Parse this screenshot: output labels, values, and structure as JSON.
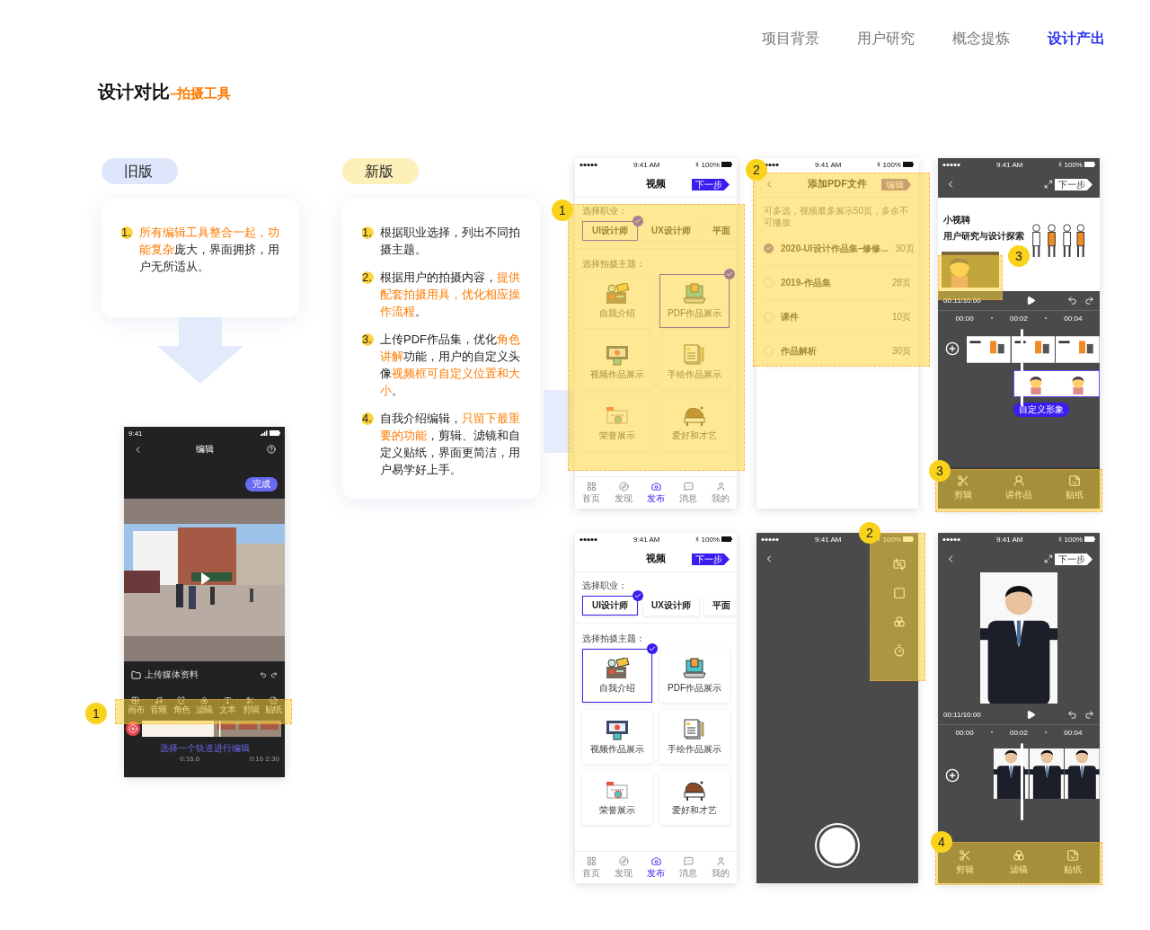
{
  "nav": [
    {
      "label": "项目背景",
      "selected": false
    },
    {
      "label": "用户研究",
      "selected": false
    },
    {
      "label": "概念提炼",
      "selected": false
    },
    {
      "label": "设计产出",
      "selected": true
    }
  ],
  "heading": {
    "title": "设计对比",
    "subtitle": "–拍摄工具"
  },
  "old_version": {
    "badge": "旧版",
    "points": [
      {
        "number": "1.",
        "segments": [
          {
            "text": "所有编辑工具整合一起，功能复杂",
            "highlight": true
          },
          {
            "text": "庞大，界面拥挤，用户无所适从。",
            "highlight": false
          }
        ]
      }
    ],
    "phone": {
      "callout": "1",
      "time": "9:41",
      "title": "编辑",
      "done": "完成",
      "upload": "上传媒体资料",
      "tools": [
        {
          "kind": "canvas",
          "label": "画布"
        },
        {
          "kind": "audio",
          "label": "音频"
        },
        {
          "kind": "role",
          "label": "角色"
        },
        {
          "kind": "filter",
          "label": "滤镜"
        },
        {
          "kind": "text",
          "label": "文本"
        },
        {
          "kind": "cut",
          "label": "剪辑"
        },
        {
          "kind": "sticker",
          "label": "贴纸"
        }
      ],
      "hint": "选择一个轨道进行编辑",
      "times": [
        "0:16.6",
        "0:16 2:30"
      ]
    }
  },
  "new_version": {
    "badge": "新版",
    "points": [
      {
        "number": "1.",
        "segments": [
          {
            "text": "根据职业选择，列出不同拍摄主题。",
            "highlight": false
          }
        ]
      },
      {
        "number": "2.",
        "segments": [
          {
            "text": "根据用户的拍摄内容，",
            "highlight": false
          },
          {
            "text": "提供配套拍摄用具，优化相应操作流程",
            "highlight": true
          },
          {
            "text": "。",
            "highlight": false
          }
        ]
      },
      {
        "number": "3.",
        "segments": [
          {
            "text": "上传PDF作品集，优化",
            "highlight": false
          },
          {
            "text": "角色讲解",
            "highlight": true
          },
          {
            "text": "功能，用户的自定义头像",
            "highlight": false
          },
          {
            "text": "视频框可自定义位置和大小",
            "highlight": true
          },
          {
            "text": "。",
            "highlight": false
          }
        ]
      },
      {
        "number": "4.",
        "segments": [
          {
            "text": "自我介绍编辑，",
            "highlight": false
          },
          {
            "text": "只留下最重要的功能",
            "highlight": true
          },
          {
            "text": "，剪辑、滤镜和自定义贴纸，界面更简洁，用户易学好上手。",
            "highlight": false
          }
        ]
      }
    ]
  },
  "screens": [
    {
      "kind": "choose",
      "callouts": [
        "1"
      ],
      "status": {
        "time": "9:41 AM",
        "battery": "100%"
      },
      "title": "视频",
      "next": "下一步",
      "job_label": "选择职业：",
      "jobs": [
        {
          "label": "UI设计师",
          "selected": true
        },
        {
          "label": "UX设计师",
          "selected": false
        },
        {
          "label": "平面",
          "selected": false
        }
      ],
      "theme_label": "选择拍摄主题：",
      "themes": [
        {
          "label": "自我介绍",
          "selected": false
        },
        {
          "label": "PDF作品展示",
          "selected": true
        },
        {
          "label": "视频作品展示",
          "selected": false
        },
        {
          "label": "手绘作品展示",
          "selected": false
        },
        {
          "label": "荣誉展示",
          "selected": false
        },
        {
          "label": "爱好和才艺",
          "selected": false
        }
      ],
      "tabs": [
        {
          "label": "首页",
          "selected": false
        },
        {
          "label": "发现",
          "selected": false
        },
        {
          "label": "发布",
          "selected": true
        },
        {
          "label": "消息",
          "selected": false
        },
        {
          "label": "我的",
          "selected": false
        }
      ]
    },
    {
      "kind": "pdf",
      "callouts": [
        "2"
      ],
      "status": {
        "time": "9:41 AM",
        "battery": "100%"
      },
      "title": "添加PDF文件",
      "action": "编辑",
      "hint": "可多选，视频最多展示50页，多余不可播放",
      "files": [
        {
          "name": "2020-UI设计作品集–修修...",
          "pages": "30页",
          "checked": true
        },
        {
          "name": "2019-作品集",
          "pages": "28页",
          "checked": false
        },
        {
          "name": "课件",
          "pages": "10页",
          "checked": false
        },
        {
          "name": "作品解析",
          "pages": "30页",
          "checked": false
        }
      ]
    },
    {
      "kind": "editor",
      "callouts": [
        "3",
        "3"
      ],
      "status": {
        "time": "9:41 AM",
        "battery": "100%"
      },
      "next": "下一步",
      "slide": {
        "title": "小视聘",
        "subtitle": "用户研究与设计探索"
      },
      "time": "00:11/10:00",
      "ticks": [
        "00:00",
        "00:02",
        "00:04"
      ],
      "track_tag": "自定义形象",
      "tools": [
        {
          "kind": "cut",
          "label": "剪辑"
        },
        {
          "kind": "present",
          "label": "讲作品"
        },
        {
          "kind": "sticker",
          "label": "贴纸"
        }
      ]
    },
    {
      "kind": "choose",
      "status": {
        "time": "9:41 AM",
        "battery": "100%"
      },
      "title": "视频",
      "next": "下一步",
      "job_label": "选择职业：",
      "jobs": [
        {
          "label": "UI设计师",
          "selected": true
        },
        {
          "label": "UX设计师",
          "selected": false
        },
        {
          "label": "平面",
          "selected": false
        }
      ],
      "theme_label": "选择拍摄主题：",
      "themes": [
        {
          "label": "自我介绍",
          "selected": true
        },
        {
          "label": "PDF作品展示",
          "selected": false
        },
        {
          "label": "视频作品展示",
          "selected": false
        },
        {
          "label": "手绘作品展示",
          "selected": false
        },
        {
          "label": "荣誉展示",
          "selected": false
        },
        {
          "label": "爱好和才艺",
          "selected": false
        }
      ],
      "tabs": [
        {
          "label": "首页",
          "selected": false
        },
        {
          "label": "发现",
          "selected": false
        },
        {
          "label": "发布",
          "selected": true
        },
        {
          "label": "消息",
          "selected": false
        },
        {
          "label": "我的",
          "selected": false
        }
      ]
    },
    {
      "kind": "camera",
      "callouts": [
        "2"
      ],
      "status": {
        "time": "9:41 AM",
        "battery": "100%"
      }
    },
    {
      "kind": "editor",
      "callouts": [
        "4"
      ],
      "status": {
        "time": "9:41 AM",
        "battery": "100%"
      },
      "next": "下一步",
      "time": "00:11/10:00",
      "ticks": [
        "00:00",
        "00:02",
        "00:04"
      ],
      "tools": [
        {
          "kind": "cut",
          "label": "剪辑"
        },
        {
          "kind": "filter",
          "label": "滤镜"
        },
        {
          "kind": "sticker",
          "label": "贴纸"
        }
      ]
    }
  ]
}
